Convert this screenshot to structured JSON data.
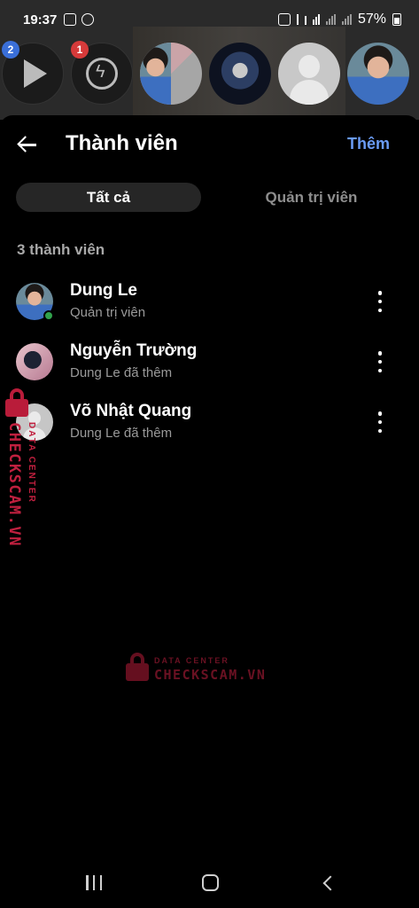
{
  "status_bar": {
    "time": "19:37",
    "battery_percent": "57%"
  },
  "chat_heads": {
    "badges": [
      "2",
      "1"
    ]
  },
  "sheet": {
    "title": "Thành viên",
    "add_label": "Thêm",
    "tabs": [
      {
        "label": "Tất cả",
        "active": true
      },
      {
        "label": "Quản trị viên",
        "active": false
      }
    ],
    "member_count": "3 thành viên",
    "members": [
      {
        "name": "Dung Le",
        "subtitle": "Quản trị viên",
        "online": true
      },
      {
        "name": "Nguyễn Trường",
        "subtitle": "Dung Le đã thêm",
        "online": false
      },
      {
        "name": "Võ Nhật Quang",
        "subtitle": "Dung Le đã thêm",
        "online": false
      }
    ]
  },
  "watermark": {
    "brand": "CHECKSCAM.VN",
    "tagline": "DATA CENTER"
  },
  "colors": {
    "accent": "#6a9bf4",
    "online": "#31a24c",
    "watermark": "#c0203f"
  }
}
